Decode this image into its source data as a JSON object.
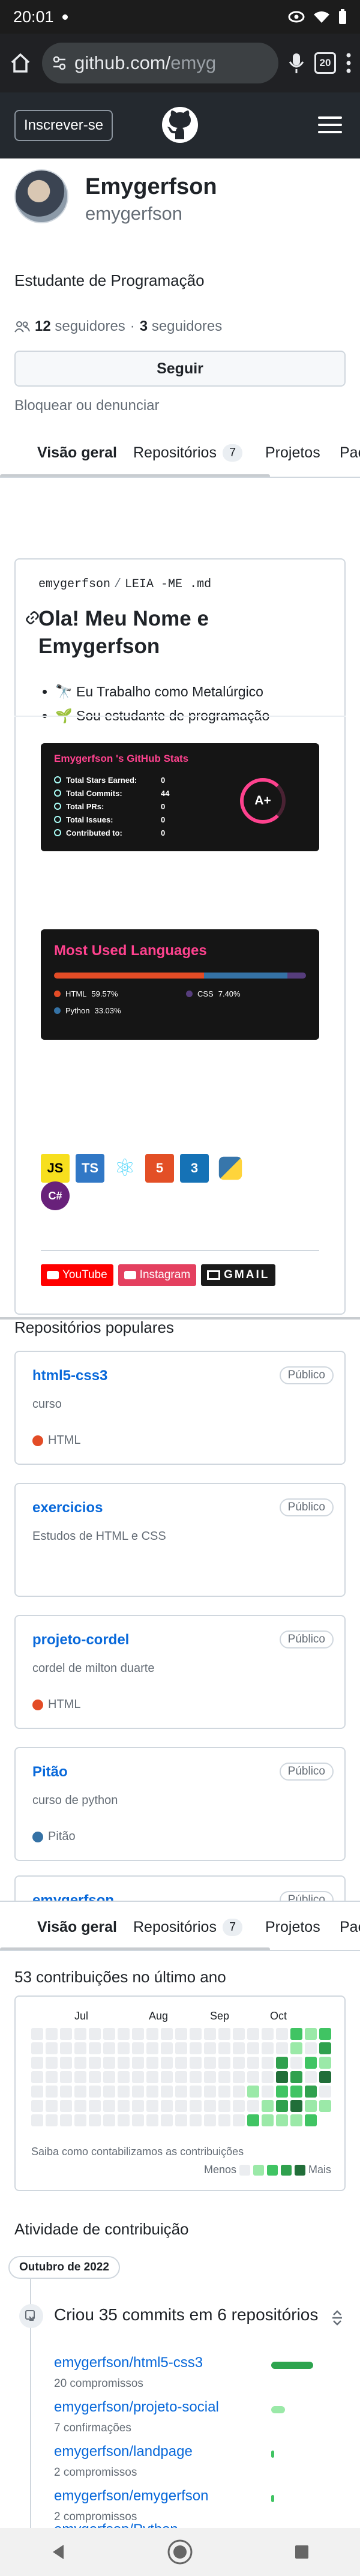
{
  "status_bar": {
    "time": "20:01"
  },
  "browser": {
    "url_host": "github.com/",
    "url_rest": "emyg",
    "tab_count": "20"
  },
  "header": {
    "signup_label": "Inscrever-se"
  },
  "profile": {
    "name": "Emygerfson",
    "username": "emygerfson",
    "bio": "Estudante de Programação",
    "followers_count": "12",
    "followers_label": "seguidores",
    "separator": "·",
    "following_count": "3",
    "following_label": "seguidores",
    "follow_button": "Seguir",
    "block_report": "Bloquear ou denunciar"
  },
  "tabs": [
    {
      "label": "Visão geral"
    },
    {
      "label": "Repositórios",
      "count": "7"
    },
    {
      "label": "Projetos"
    },
    {
      "label": "Pac"
    }
  ],
  "readme": {
    "path_user": "emygerfson",
    "path_sep": "/",
    "path_file": "LEIA -ME .md",
    "heading": "Ola! Meu Nome e Emygerfson",
    "list": [
      "🔭 Eu Trabalho como Metalúrgico",
      "🌱 Sou estudante de programação"
    ],
    "stats_card": {
      "title": "Emygerfson 's GitHub Stats",
      "rows": [
        {
          "label": "Total Stars Earned:",
          "value": "0"
        },
        {
          "label": "Total Commits:",
          "value": "44"
        },
        {
          "label": "Total PRs:",
          "value": "0"
        },
        {
          "label": "Total Issues:",
          "value": "0"
        },
        {
          "label": "Contributed to:",
          "value": "0"
        }
      ],
      "grade": "A+"
    },
    "languages_card": {
      "title": "Most Used Languages",
      "languages": [
        {
          "name": "HTML",
          "percent_label": "59.57%",
          "percent": 59.57,
          "color": "#e34c26"
        },
        {
          "name": "CSS",
          "percent_label": "7.40%",
          "percent": 7.4,
          "color": "#563d7c"
        },
        {
          "name": "Python",
          "percent_label": "33.03%",
          "percent": 33.03,
          "color": "#3572A5"
        }
      ]
    },
    "tech_badges": [
      {
        "icon": "javascript-icon",
        "text": "JS",
        "bg": "#f7df1e",
        "fg": "#000000"
      },
      {
        "icon": "typescript-icon",
        "text": "TS",
        "bg": "#3178c6",
        "fg": "#ffffff"
      },
      {
        "icon": "react-icon",
        "text": "⚛",
        "bg": "#ffffff",
        "fg": "#61dafb"
      },
      {
        "icon": "html5-icon",
        "text": "5",
        "bg": "#e34f26",
        "fg": "#ffffff"
      },
      {
        "icon": "css3-icon",
        "text": "3",
        "bg": "#1572b6",
        "fg": "#ffffff"
      },
      {
        "icon": "python-icon",
        "text": "",
        "bg": "#ffffff",
        "fg": "#3776ab"
      },
      {
        "icon": "csharp-icon",
        "text": "C#",
        "bg": "#68217a",
        "fg": "#ffffff"
      }
    ],
    "contacts": [
      {
        "icon": "youtube-icon",
        "label": "YouTube",
        "bg": "#ff0000"
      },
      {
        "icon": "instagram-icon",
        "label": "Instagram",
        "bg": "#e4405f"
      },
      {
        "icon": "gmail-icon",
        "label": "GMAIL",
        "bg": "#1a1a1a"
      }
    ]
  },
  "popular_repos": {
    "title": "Repositórios populares",
    "items": [
      {
        "name": "html5-css3",
        "badge": "Público",
        "description": "curso",
        "language": "HTML",
        "language_color": "#e34c26"
      },
      {
        "name": "exercicios",
        "badge": "Público",
        "description": "Estudos de HTML e CSS",
        "language": "",
        "language_color": ""
      },
      {
        "name": "projeto-cordel",
        "badge": "Público",
        "description": "cordel de milton duarte",
        "language": "HTML",
        "language_color": "#e34c26"
      },
      {
        "name": "Pitão",
        "badge": "Público",
        "description": "curso de python",
        "language": "Pitão",
        "language_color": "#3572A5"
      },
      {
        "name": "emygerfson",
        "badge": "Público",
        "description": "",
        "language": "",
        "language_color": ""
      }
    ]
  },
  "contributions": {
    "title": "53 contribuições no último ano",
    "months": [
      "Jul",
      "Aug",
      "Sep",
      "Oct"
    ],
    "footer": "Saiba como contabilizamos as contribuições",
    "legend_less": "Menos",
    "legend_more": "Mais",
    "levels": [
      "#ebedf0",
      "#9be9a8",
      "#40c463",
      "#30a14e",
      "#216e39"
    ]
  },
  "activity": {
    "title": "Atividade de contribuição",
    "month": "Outubro de 2022",
    "headline": "Criou 35 commits em 6 repositórios",
    "rows": [
      {
        "repo": "emygerfson/html5-css3",
        "sub": "20 compromissos",
        "share": 1.0
      },
      {
        "repo": "emygerfson/projeto-social",
        "sub": "7 confirmações",
        "share": 0.33
      },
      {
        "repo": "emygerfson/landpage",
        "sub": "2 compromissos",
        "share": 0.08
      },
      {
        "repo": "emygerfson/emygerfson",
        "sub": "2 compromissos",
        "share": 0.08
      },
      {
        "repo": "emygerfson/Python",
        "sub": "",
        "share": 0.08
      }
    ]
  }
}
